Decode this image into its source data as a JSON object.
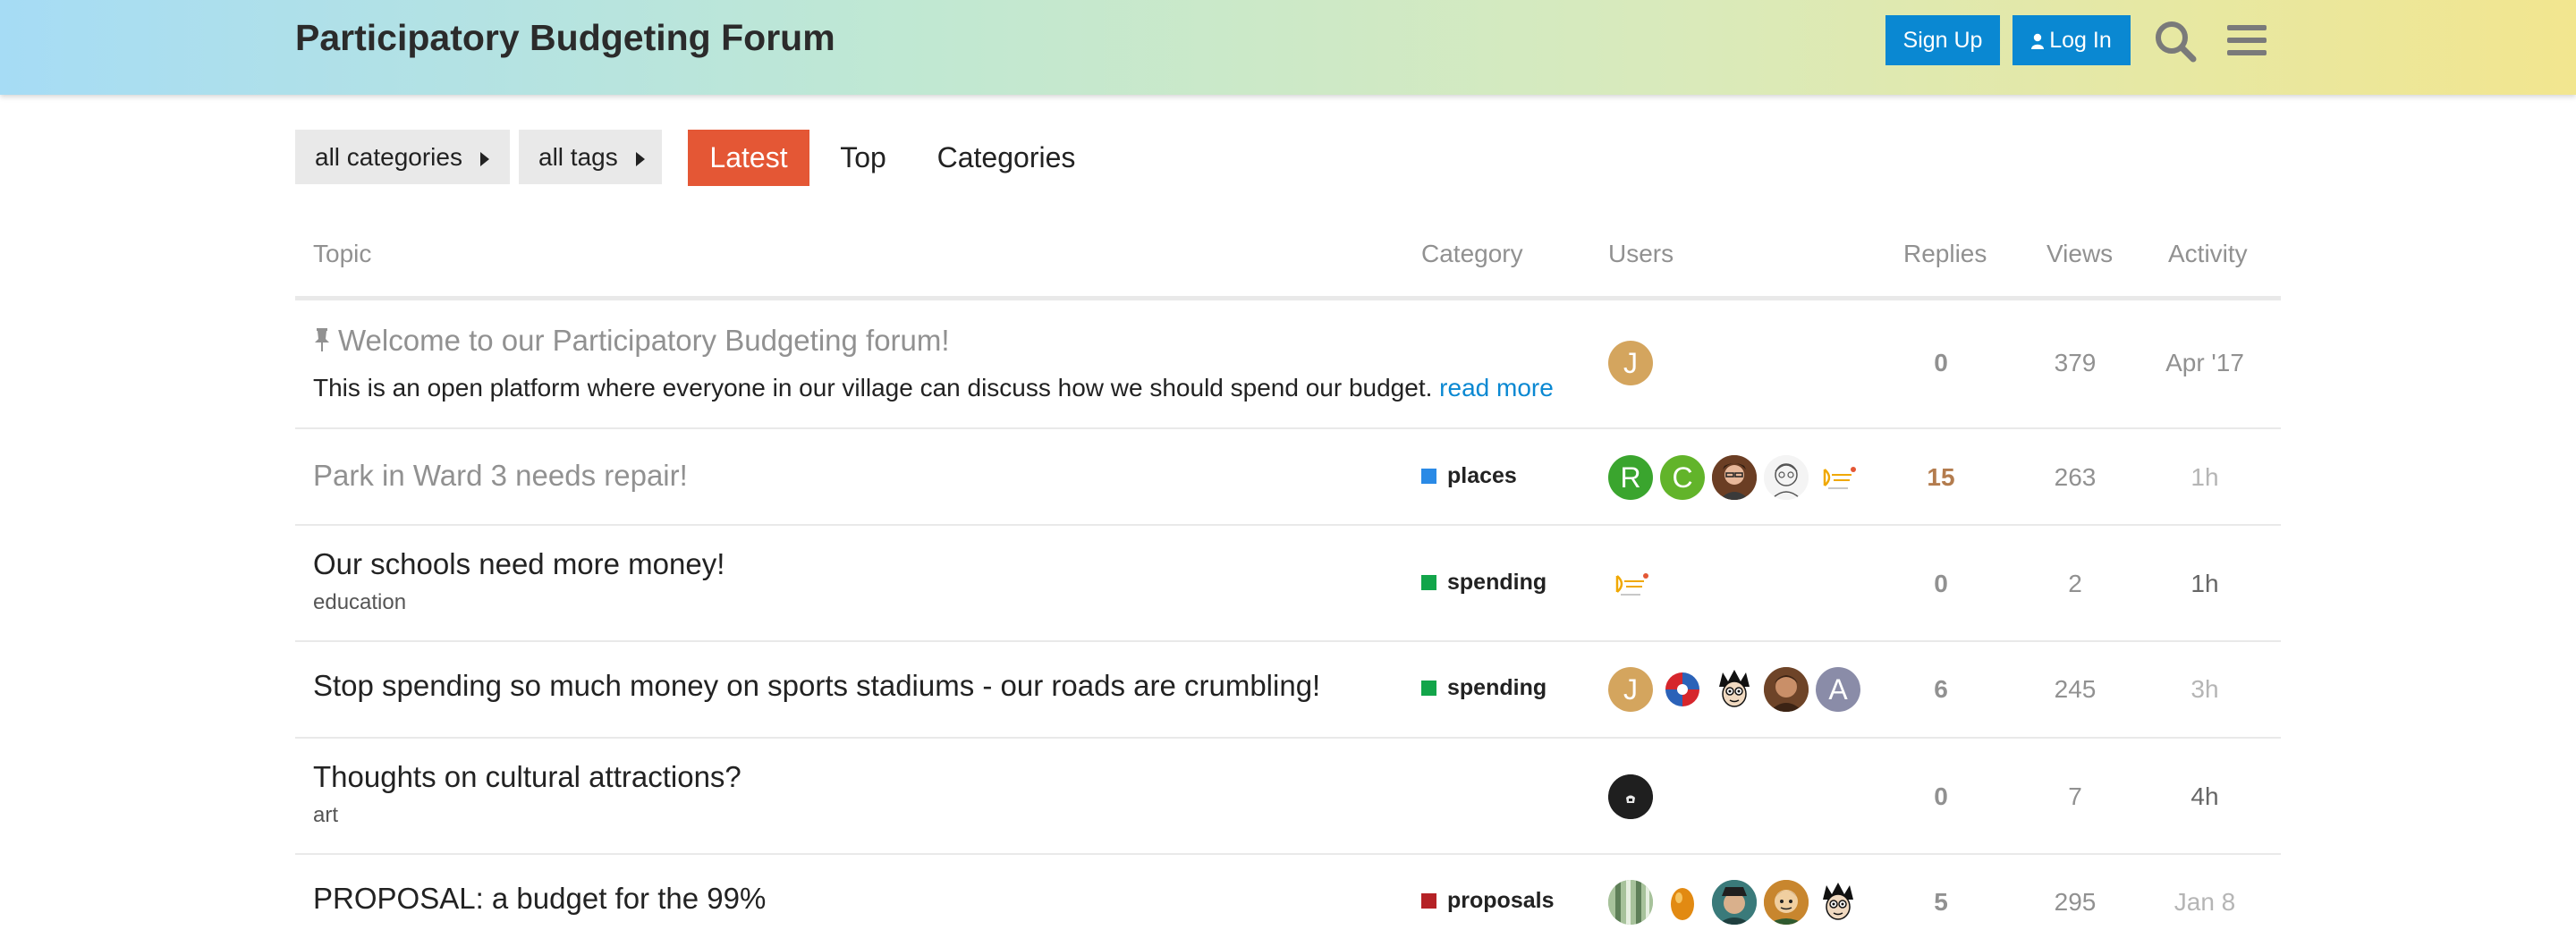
{
  "header": {
    "site_title": "Participatory Budgeting Forum",
    "signup_label": "Sign Up",
    "login_label": "Log In",
    "brand_color": "#0a88d2"
  },
  "nav": {
    "categories_dropdown": "all categories",
    "tags_dropdown": "all tags",
    "tabs": [
      "Latest",
      "Top",
      "Categories"
    ],
    "active_tab": "Latest",
    "active_color": "#e45735"
  },
  "table": {
    "columns": [
      "Topic",
      "Category",
      "Users",
      "Replies",
      "Views",
      "Activity"
    ],
    "topics": [
      {
        "title": "Welcome to our Participatory Budgeting forum!",
        "pinned": true,
        "excerpt": "This is an open platform where everyone in our village can discuss how we should spend our budget.",
        "read_more": "read more",
        "category": "",
        "users": [
          {
            "letter": "J",
            "color": "#d4a55e"
          }
        ],
        "replies": "0",
        "views": "379",
        "activity": "Apr '17"
      },
      {
        "title": "Park in Ward 3 needs repair!",
        "category": "places",
        "category_color": "#2a8ae6",
        "users": [
          {
            "letter": "R",
            "color": "#3aa52e"
          },
          {
            "letter": "C",
            "color": "#62b42a"
          },
          {
            "letter": "",
            "color": "#7a4a2e"
          },
          {
            "letter": "",
            "color": "#dcdcdc"
          },
          {
            "letter": "",
            "color": "#fff2c4"
          }
        ],
        "replies": "15",
        "views": "263",
        "activity": "1h"
      },
      {
        "title": "Our schools need more money!",
        "tag": "education",
        "category": "spending",
        "category_color": "#12a54a",
        "users": [
          {
            "letter": "",
            "color": "#fff2c4"
          }
        ],
        "replies": "0",
        "views": "2",
        "activity": "1h"
      },
      {
        "title": "Stop spending so much money on sports stadiums - our roads are crumbling!",
        "category": "spending",
        "category_color": "#12a54a",
        "users": [
          {
            "letter": "J",
            "color": "#d4a55e"
          },
          {
            "letter": "",
            "color": "#2b62b8"
          },
          {
            "letter": "",
            "color": "#ffffff"
          },
          {
            "letter": "",
            "color": "#8a5a3a"
          },
          {
            "letter": "A",
            "color": "#8a8ca8"
          }
        ],
        "replies": "6",
        "views": "245",
        "activity": "3h"
      },
      {
        "title": "Thoughts on cultural attractions?",
        "tag": "art",
        "category": "",
        "users": [
          {
            "letter": "",
            "color": "#222222"
          }
        ],
        "replies": "0",
        "views": "7",
        "activity": "4h"
      },
      {
        "title": "PROPOSAL: a budget for the 99%",
        "category": "proposals",
        "category_color": "#b52226",
        "users": [
          {
            "letter": "",
            "color": "#8fae84"
          },
          {
            "letter": "",
            "color": "#e28a12"
          },
          {
            "letter": "",
            "color": "#3a7a7a"
          },
          {
            "letter": "",
            "color": "#c8862e"
          },
          {
            "letter": "",
            "color": "#ffffff"
          }
        ],
        "replies": "5",
        "views": "295",
        "activity": "Jan 8"
      }
    ]
  }
}
